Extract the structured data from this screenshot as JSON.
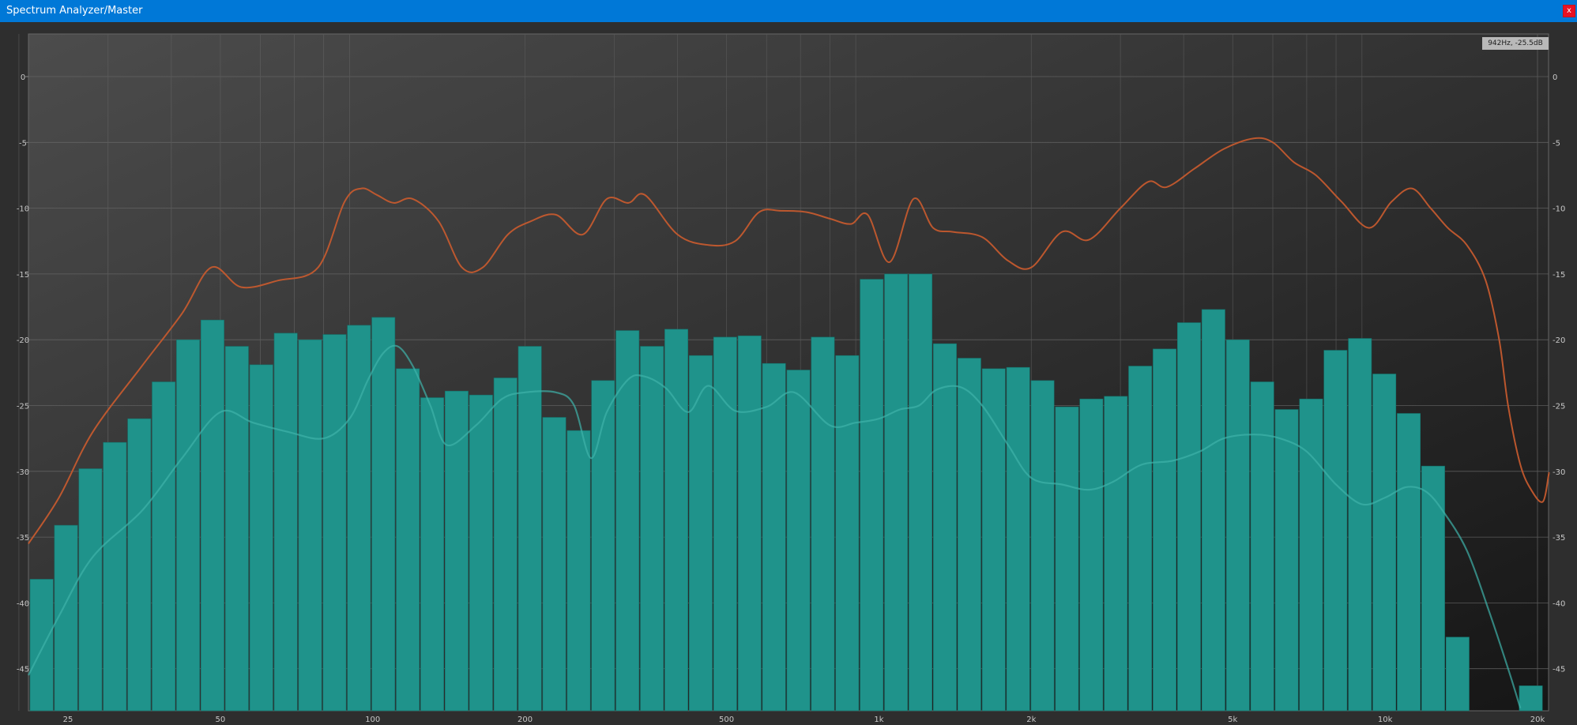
{
  "window": {
    "title": "Spectrum Analyzer/Master",
    "close_label": "x"
  },
  "readout": "942Hz, -25.5dB",
  "colors": {
    "bars": "#1f938b",
    "peak_curve": "#c45a2e",
    "avg_curve": "#3fb2aa",
    "titlebar": "#0078d7"
  },
  "chart_data": {
    "type": "bar",
    "x_scale": "log",
    "xlim_hz": [
      20,
      25000
    ],
    "ylim_db": [
      -48,
      3.5
    ],
    "grid": true,
    "x_ticks": [
      {
        "hz": 25,
        "label": "25"
      },
      {
        "hz": 50,
        "label": "50"
      },
      {
        "hz": 100,
        "label": "100"
      },
      {
        "hz": 200,
        "label": "200"
      },
      {
        "hz": 500,
        "label": "500"
      },
      {
        "hz": 1000,
        "label": "1k"
      },
      {
        "hz": 2000,
        "label": "2k"
      },
      {
        "hz": 5000,
        "label": "5k"
      },
      {
        "hz": 10000,
        "label": "10k"
      },
      {
        "hz": 20000,
        "label": "20k"
      }
    ],
    "y_ticks": [
      0,
      -5,
      -10,
      -15,
      -20,
      -25,
      -30,
      -35,
      -40,
      -45
    ],
    "y_tick_labels": [
      "0",
      "-5",
      "-10",
      "-15",
      "-20",
      "-25",
      "-30",
      "-35",
      "-40",
      "-45"
    ],
    "bars_db": [
      -38.2,
      -34.1,
      -29.8,
      -27.8,
      -26.0,
      -23.2,
      -20.0,
      -18.5,
      -20.5,
      -21.9,
      -19.5,
      -20.0,
      -19.6,
      -18.9,
      -18.3,
      -22.2,
      -24.4,
      -23.9,
      -24.2,
      -22.9,
      -20.5,
      -25.9,
      -26.9,
      -23.1,
      -19.3,
      -20.5,
      -19.2,
      -21.2,
      -19.8,
      -19.7,
      -21.8,
      -22.3,
      -19.8,
      -21.2,
      -15.4,
      -15.0,
      -15.0,
      -20.3,
      -21.4,
      -22.2,
      -22.1,
      -23.1,
      -25.1,
      -24.5,
      -24.3,
      -22.0,
      -20.7,
      -18.7,
      -17.7,
      -20.0,
      -23.2,
      -25.3,
      -24.5,
      -20.8,
      -19.9,
      -22.6,
      -25.6,
      -29.6,
      -42.6,
      null,
      null,
      -46.3
    ],
    "series": [
      {
        "name": "peak",
        "points": [
          [
            20,
            -35.5
          ],
          [
            24,
            -32
          ],
          [
            28,
            -27
          ],
          [
            35,
            -22
          ],
          [
            42,
            -18
          ],
          [
            48,
            -14.5
          ],
          [
            55,
            -16
          ],
          [
            65,
            -15.5
          ],
          [
            78,
            -14.5
          ],
          [
            88,
            -9.5
          ],
          [
            95,
            -8.5
          ],
          [
            102,
            -9
          ],
          [
            110,
            -9.6
          ],
          [
            120,
            -9.3
          ],
          [
            135,
            -11
          ],
          [
            150,
            -14.5
          ],
          [
            165,
            -14.5
          ],
          [
            185,
            -12
          ],
          [
            205,
            -11
          ],
          [
            230,
            -10.5
          ],
          [
            260,
            -12
          ],
          [
            290,
            -9.3
          ],
          [
            320,
            -9.6
          ],
          [
            345,
            -9
          ],
          [
            400,
            -12
          ],
          [
            460,
            -12.8
          ],
          [
            520,
            -12.5
          ],
          [
            580,
            -10.3
          ],
          [
            640,
            -10.2
          ],
          [
            720,
            -10.3
          ],
          [
            800,
            -10.8
          ],
          [
            880,
            -11.2
          ],
          [
            950,
            -10.5
          ],
          [
            1050,
            -14.1
          ],
          [
            1170,
            -9.3
          ],
          [
            1280,
            -11.5
          ],
          [
            1400,
            -11.8
          ],
          [
            1600,
            -12.2
          ],
          [
            1800,
            -14
          ],
          [
            2000,
            -14.5
          ],
          [
            2300,
            -11.8
          ],
          [
            2600,
            -12.4
          ],
          [
            3000,
            -10
          ],
          [
            3400,
            -8
          ],
          [
            3700,
            -8.4
          ],
          [
            4200,
            -7
          ],
          [
            4800,
            -5.5
          ],
          [
            5500,
            -4.7
          ],
          [
            6000,
            -5
          ],
          [
            6600,
            -6.5
          ],
          [
            7300,
            -7.5
          ],
          [
            8200,
            -9.5
          ],
          [
            9300,
            -11.5
          ],
          [
            10300,
            -9.5
          ],
          [
            11300,
            -8.5
          ],
          [
            12300,
            -10
          ],
          [
            13300,
            -11.5
          ],
          [
            14500,
            -12.8
          ],
          [
            15800,
            -15.5
          ],
          [
            16800,
            -20
          ],
          [
            17500,
            -25
          ],
          [
            18500,
            -29.5
          ],
          [
            19500,
            -31.5
          ],
          [
            20500,
            -32.3
          ],
          [
            22000,
            -30.3
          ],
          [
            23500,
            -30.2
          ]
        ]
      },
      {
        "name": "average",
        "points": [
          [
            20,
            -45.5
          ],
          [
            24,
            -41
          ],
          [
            28,
            -36.5
          ],
          [
            35,
            -33
          ],
          [
            42,
            -29
          ],
          [
            50,
            -25.5
          ],
          [
            58,
            -26.3
          ],
          [
            68,
            -27
          ],
          [
            80,
            -27.5
          ],
          [
            90,
            -26
          ],
          [
            98,
            -23
          ],
          [
            105,
            -21
          ],
          [
            112,
            -20.5
          ],
          [
            120,
            -22
          ],
          [
            130,
            -25
          ],
          [
            140,
            -28
          ],
          [
            160,
            -26.5
          ],
          [
            180,
            -24.5
          ],
          [
            200,
            -24
          ],
          [
            230,
            -24
          ],
          [
            250,
            -25
          ],
          [
            270,
            -29
          ],
          [
            290,
            -25.5
          ],
          [
            320,
            -23
          ],
          [
            345,
            -22.8
          ],
          [
            380,
            -23.7
          ],
          [
            420,
            -25.5
          ],
          [
            460,
            -23.5
          ],
          [
            520,
            -25.4
          ],
          [
            600,
            -25.1
          ],
          [
            680,
            -24
          ],
          [
            800,
            -26.5
          ],
          [
            900,
            -26.3
          ],
          [
            1000,
            -26
          ],
          [
            1100,
            -25.3
          ],
          [
            1200,
            -25
          ],
          [
            1300,
            -23.8
          ],
          [
            1450,
            -23.6
          ],
          [
            1600,
            -25
          ],
          [
            1800,
            -28
          ],
          [
            2000,
            -30.5
          ],
          [
            2300,
            -31
          ],
          [
            2600,
            -31.4
          ],
          [
            2900,
            -30.8
          ],
          [
            3300,
            -29.5
          ],
          [
            3800,
            -29.2
          ],
          [
            4300,
            -28.5
          ],
          [
            4800,
            -27.5
          ],
          [
            5500,
            -27.2
          ],
          [
            6200,
            -27.5
          ],
          [
            7000,
            -28.5
          ],
          [
            8000,
            -31
          ],
          [
            9000,
            -32.5
          ],
          [
            10000,
            -32
          ],
          [
            11000,
            -31.2
          ],
          [
            12000,
            -31.5
          ],
          [
            13000,
            -33
          ],
          [
            14500,
            -36
          ],
          [
            16000,
            -40.5
          ],
          [
            17500,
            -45
          ],
          [
            18500,
            -48
          ]
        ]
      }
    ]
  }
}
